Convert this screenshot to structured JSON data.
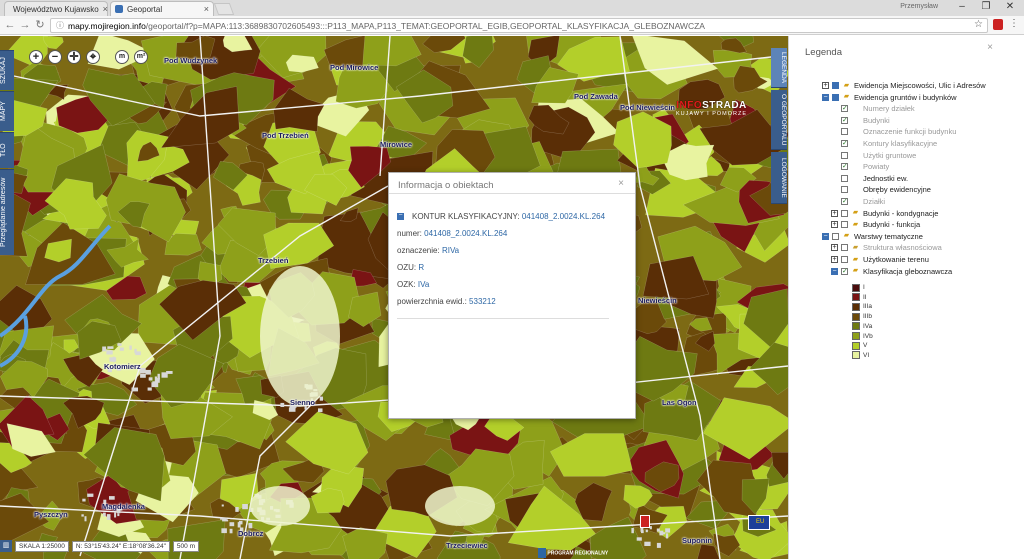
{
  "browser": {
    "tabs": [
      {
        "title": "Województwo Kujawsko",
        "favicon_color": "#d33b2f"
      },
      {
        "title": "Geoportal",
        "favicon_color": "#3a6fb3"
      }
    ],
    "user_label": "Przemysław",
    "url_host": "mapy.mojiregion.info",
    "url_rest": "/geoportal/f?p=MAPA:113:3689830702605493:::P113_MAPA,P113_TEMAT:GEOPORTAL_EGIB,GEOPORTAL_KLASYFIKACJA_GLEBOZNAWCZA",
    "win_min": "–",
    "win_max": "❐",
    "win_close": "✕"
  },
  "map": {
    "left_tabs": [
      "SZUKAJ",
      "MAPY",
      "TŁO",
      "Przeglądanie adresów"
    ],
    "right_tabs": [
      "LEGENDA",
      "O GEOPORTALU",
      "LOGOWANIE"
    ],
    "controls": [
      "+",
      "−",
      "✛",
      "⌖",
      "m",
      "m²"
    ],
    "logo_a": "INFO",
    "logo_b": "STRADA",
    "logo_sub": "KUJAWY I POMORZE",
    "places": [
      "Pod Wudzynek",
      "Pod Mirowice",
      "Pod Zawada",
      "Pod Niewieścin",
      "Pod Trzebień",
      "Mirowice",
      "Trzebień",
      "Kotomierz",
      "Sienno",
      "Las Ogon",
      "Magdalenka",
      "Pyszczyn",
      "Dobrcz",
      "Trzeciewiec",
      "Suponin",
      "Niewieścin"
    ],
    "status": {
      "scale": "SKALA 1:25000",
      "coords": "N: 53°15'43.24\" E:18°08'36.24\"",
      "scalebar": "500 m"
    },
    "footer_logo": "PROGRAM REGIONALNY",
    "eu_logo": "EU"
  },
  "dialog": {
    "title": "Informacja o obiektach",
    "close": "×",
    "section_label": "KONTUR KLASYFIKACYJNY:",
    "section_value": "041408_2.0024.KL.264",
    "fields": [
      {
        "label": "numer:",
        "value": "041408_2.0024.KL.264"
      },
      {
        "label": "oznaczenie:",
        "value": "RIVa"
      },
      {
        "label": "OZU:",
        "value": "R"
      },
      {
        "label": "OZK:",
        "value": "IVa"
      },
      {
        "label": "powierzchnia ewid.:",
        "value": "533212"
      }
    ]
  },
  "legend": {
    "title": "Legenda",
    "close": "×",
    "items": [
      {
        "label": "Ewidencja Miejscowości, Ulic i Adresów",
        "expander": "+",
        "checked": true,
        "level": 0,
        "muted": false
      },
      {
        "label": "Ewidencja gruntów i budynków",
        "expander": "−",
        "checked": true,
        "level": 0,
        "muted": false
      },
      {
        "label": "Numery działek",
        "checked": true,
        "level": 1,
        "muted": true
      },
      {
        "label": "Budynki",
        "checked": true,
        "level": 1,
        "muted": true
      },
      {
        "label": "Oznaczenie funkcji budynku",
        "checked": false,
        "level": 1,
        "muted": true
      },
      {
        "label": "Kontury klasyfikacyjne",
        "checked": true,
        "level": 1,
        "muted": true
      },
      {
        "label": "Użytki gruntowe",
        "checked": false,
        "level": 1,
        "muted": true
      },
      {
        "label": "Powiaty",
        "checked": true,
        "level": 1,
        "muted": true
      },
      {
        "label": "Jednostki ew.",
        "checked": false,
        "level": 1,
        "muted": false
      },
      {
        "label": "Obręby ewidencyjne",
        "checked": false,
        "level": 1,
        "muted": false
      },
      {
        "label": "Działki",
        "checked": true,
        "level": 1,
        "muted": true
      },
      {
        "label": "Budynki - kondygnacje",
        "expander": "+",
        "checked": false,
        "level": 1,
        "muted": false
      },
      {
        "label": "Budynki - funkcja",
        "expander": "+",
        "checked": false,
        "level": 1,
        "muted": false
      },
      {
        "label": "Warstwy tematyczne",
        "expander": "−",
        "checked": false,
        "level": 0,
        "muted": false
      },
      {
        "label": "Struktura własnościowa",
        "expander": "+",
        "checked": false,
        "level": 1,
        "muted": true
      },
      {
        "label": "Użytkowanie terenu",
        "expander": "+",
        "checked": false,
        "level": 1,
        "muted": false
      },
      {
        "label": "Klasyfikacja gleboznawcza",
        "expander": "−",
        "checked": true,
        "level": 1,
        "muted": false
      }
    ],
    "swatches": [
      {
        "label": "I",
        "color": "#4a0c0c"
      },
      {
        "label": "II",
        "color": "#7a1414"
      },
      {
        "label": "IIIa",
        "color": "#5a2e06"
      },
      {
        "label": "IIIb",
        "color": "#6b4a0a"
      },
      {
        "label": "IVa",
        "color": "#6e7a12"
      },
      {
        "label": "IVb",
        "color": "#8ea01a"
      },
      {
        "label": "V",
        "color": "#b3cf2a"
      },
      {
        "label": "VI",
        "color": "#e8f3a0"
      }
    ]
  }
}
